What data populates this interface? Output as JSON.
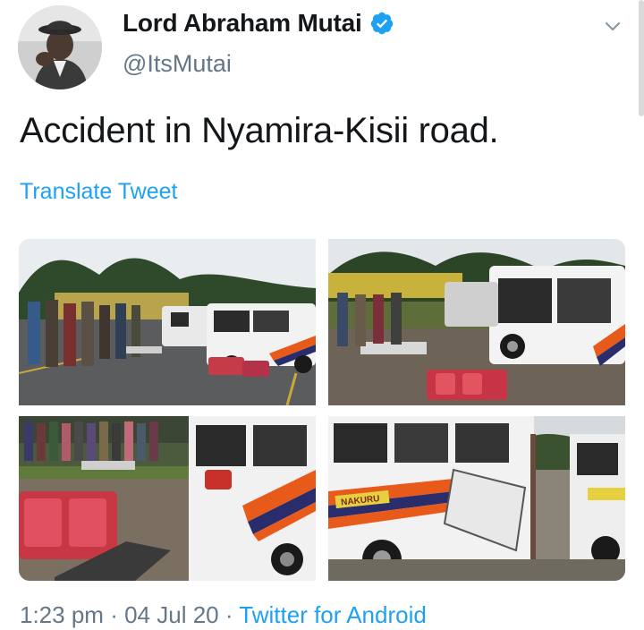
{
  "author": {
    "display_name": "Lord Abraham Mutai",
    "handle": "@ItsMutai",
    "verified": true
  },
  "tweet": {
    "text": "Accident in Nyamira-Kisii road.",
    "translate_label": "Translate Tweet",
    "time": "1:23 pm",
    "separator": "·",
    "date": "04 Jul 20",
    "source": "Twitter for Android"
  },
  "media": {
    "count": 4,
    "photo_text": "NAKURU"
  },
  "colors": {
    "link_blue": "#1da1f2",
    "secondary_gray": "#657786",
    "text_dark": "#14171a"
  },
  "icons": {
    "verified": "verified-badge-icon",
    "menu": "chevron-down-icon"
  }
}
